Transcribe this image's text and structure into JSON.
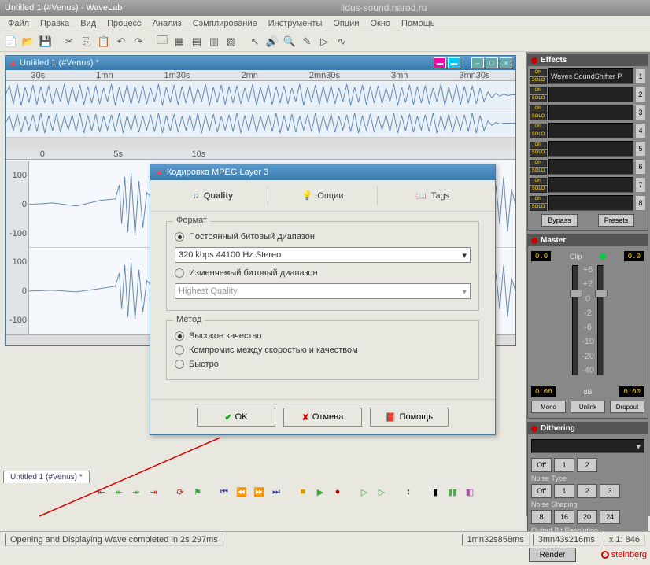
{
  "app": {
    "title": "Untitled 1 (#Venus) - WaveLab",
    "watermark": "ildus-sound.narod.ru"
  },
  "menu": [
    "Файл",
    "Правка",
    "Вид",
    "Процесс",
    "Анализ",
    "Сэмплирование",
    "Инструменты",
    "Опции",
    "Окно",
    "Помощь"
  ],
  "waveWindow": {
    "title": "Untitled 1 (#Venus) *",
    "rulerMarks": [
      "30s",
      "1mn",
      "1m30s",
      "2mn",
      "2mn30s",
      "3mn",
      "3mn30s"
    ],
    "rulerLower": [
      "0",
      "5s",
      "10s"
    ],
    "ampMarks": [
      "100",
      "0",
      "-100",
      "100",
      "0",
      "-100"
    ]
  },
  "dialog": {
    "title": "Кодировка MPEG Layer 3",
    "tabs": {
      "quality": "Quality",
      "options": "Опции",
      "tags": "Tags"
    },
    "format": {
      "legend": "Формат",
      "constant": "Постоянный битовый диапазон",
      "constantValue": "320 kbps  44100 Hz  Stereo",
      "variable": "Изменяемый битовый диапазон",
      "variableValue": "Highest Quality"
    },
    "method": {
      "legend": "Метод",
      "high": "Высокое качество",
      "compromise": "Компромис между скоростью и качеством",
      "fast": "Быстро"
    },
    "buttons": {
      "ok": "OK",
      "cancel": "Отмена",
      "help": "Помощь"
    }
  },
  "effects": {
    "title": "Effects",
    "on": "ON",
    "solo": "SOLO",
    "slot1": "Waves SoundShifter P",
    "bypass": "Bypass",
    "presets": "Presets"
  },
  "master": {
    "title": "Master",
    "val": "0.0",
    "clip": "Clip",
    "scale": [
      "+6",
      "+2",
      "0",
      "-2",
      "-6",
      "-10",
      "-20",
      "-40"
    ],
    "dbLabel": "dB",
    "mono": "Mono",
    "unlink": "Unlink",
    "dropout": "Dropout",
    "bottomVal": "0.00"
  },
  "dithering": {
    "title": "Dithering",
    "noiseType": "Noise Type",
    "noiseShaping": "Noise Shaping",
    "outputRes": "Output Bit Resolution",
    "off": "Off",
    "vals1": [
      "1",
      "2"
    ],
    "vals2": [
      "1",
      "2",
      "3"
    ],
    "vals3": [
      "8",
      "16",
      "20",
      "24"
    ]
  },
  "bottom": {
    "fileTab": "Untitled 1 (#Venus) *",
    "status": "Opening and Displaying Wave completed in 2s 297ms",
    "time1": "1mn32s858ms",
    "time2": "3mn43s216ms",
    "zoom": "x 1: 846",
    "render": "Render",
    "brand": "steinberg"
  }
}
